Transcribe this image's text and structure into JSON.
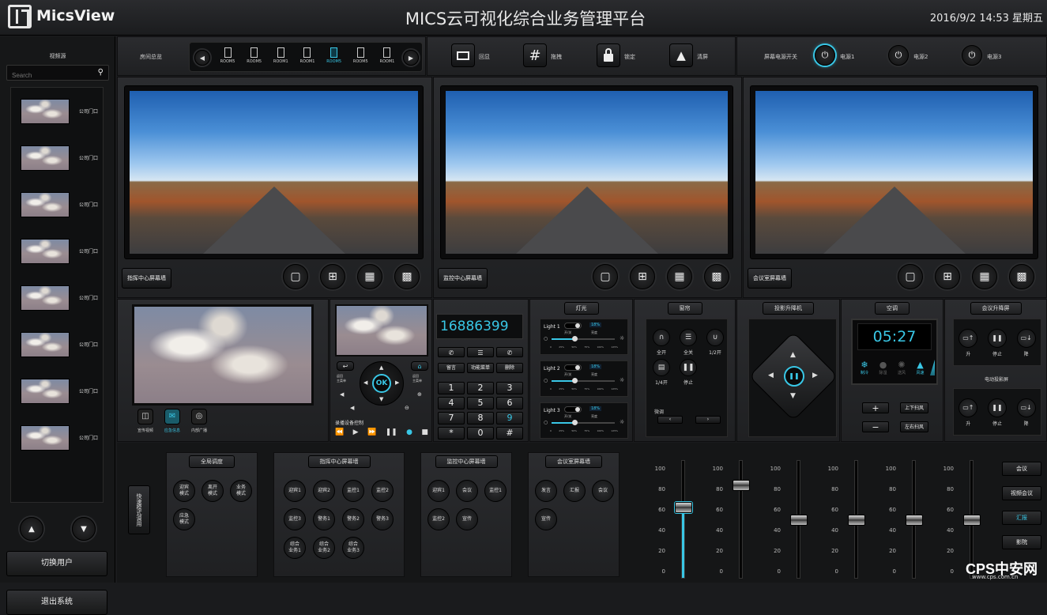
{
  "header": {
    "logo": "MicsView",
    "title": "MICS云可视化综合业务管理平台",
    "datetime": "2016/9/2 14:53 星期五"
  },
  "sidebar": {
    "title": "视频源",
    "search_placeholder": "Search",
    "items": [
      {
        "label": "公司门口"
      },
      {
        "label": "公司门口"
      },
      {
        "label": "公司门口"
      },
      {
        "label": "公司门口"
      },
      {
        "label": "公司门口"
      },
      {
        "label": "公司门口"
      },
      {
        "label": "公司门口"
      },
      {
        "label": "公司门口"
      }
    ],
    "switch_user": "切换用户",
    "logout": "退出系统"
  },
  "toolbar": {
    "room_label": "房间总览",
    "rooms": [
      "ROOM5",
      "ROOM5",
      "ROOM1",
      "ROOM1",
      "ROOM5",
      "ROOM5",
      "ROOM1"
    ],
    "actions": [
      {
        "label": "回显",
        "icon": "display-icon"
      },
      {
        "label": "拖拽",
        "icon": "grid-icon"
      },
      {
        "label": "锁定",
        "icon": "lock-icon"
      },
      {
        "label": "清屏",
        "icon": "broom-icon"
      }
    ],
    "power_label": "屏幕电源开关",
    "power": [
      {
        "label": "电源1",
        "active": true
      },
      {
        "label": "电源2",
        "active": false
      },
      {
        "label": "电源3",
        "active": false
      }
    ]
  },
  "walls": [
    {
      "label": "指挥中心屏幕墙"
    },
    {
      "label": "监控中心屏幕墙"
    },
    {
      "label": "会议室屏幕墙"
    }
  ],
  "preview": {
    "options": [
      {
        "label": "宣传视频"
      },
      {
        "label": "应急信息"
      },
      {
        "label": "内部广播"
      }
    ]
  },
  "remote": {
    "ok": "OK",
    "side_left": "返回\n主菜单",
    "side_right": "返回\n主菜单",
    "title": "录播设备控制"
  },
  "phone": {
    "number": "16886399",
    "functions": [
      "留言",
      "功能菜单",
      "删除"
    ],
    "keys": [
      "1",
      "2",
      "3",
      "4",
      "5",
      "6",
      "7",
      "8",
      "9",
      "*",
      "0",
      "#"
    ]
  },
  "lights": {
    "title": "灯光",
    "items": [
      {
        "name": "Light 1",
        "level": "18%",
        "state": "亮度"
      },
      {
        "name": "Light 2",
        "level": "18%",
        "state": "亮度"
      },
      {
        "name": "Light 3",
        "level": "18%",
        "state": "亮度"
      }
    ],
    "scale": [
      "0",
      "25%",
      "50%",
      "75%",
      "100%",
      "125%"
    ],
    "switch_label": "开/关"
  },
  "curtain": {
    "title": "窗帘",
    "buttons": [
      "全开",
      "全关",
      "1/2开",
      "1/4开",
      "停止"
    ],
    "fine": "微调"
  },
  "projector": {
    "title": "投影升降机"
  },
  "ac": {
    "title": "空调",
    "time": "05:27",
    "modes": [
      "制冷",
      "除湿",
      "送风",
      "风速"
    ],
    "swing_ud": "上下扫风",
    "swing_lr": "左右扫风",
    "plus": "+",
    "minus": "−"
  },
  "lift": {
    "title": "会议升降屏",
    "buttons": [
      "升",
      "停止",
      "降"
    ],
    "elec_title": "电动投影屏",
    "elec_buttons": [
      "升",
      "停止",
      "降"
    ]
  },
  "global": {
    "title": "全局调度",
    "buttons": [
      "迎宾\n模式",
      "离开\n模式",
      "业务\n模式",
      "应急\n模式"
    ]
  },
  "quick_mode": "快速模式调用",
  "cmd_wall": {
    "title": "指挥中心屏幕墙",
    "buttons": [
      "迎宾1",
      "迎宾2",
      "监控1",
      "监控2",
      "监控3",
      "警务1",
      "警务2",
      "警务3",
      "综合\n业务1",
      "综合\n业务2",
      "综合\n业务3"
    ]
  },
  "mon_wall": {
    "title": "监控中心屏幕墙",
    "buttons": [
      "迎宾1",
      "会议",
      "监控1",
      "监控2",
      "宣传"
    ]
  },
  "conf_wall": {
    "title": "会议室屏幕墙",
    "buttons": [
      "发言",
      "汇报",
      "会议",
      "宣传"
    ]
  },
  "mixer": {
    "scale": [
      "100",
      "80",
      "60",
      "40",
      "20",
      "0"
    ],
    "levels": [
      62,
      82,
      50,
      50,
      50,
      50
    ]
  },
  "scenes": [
    {
      "label": "会议",
      "active": false
    },
    {
      "label": "视频会议",
      "active": false
    },
    {
      "label": "汇报",
      "active": true
    },
    {
      "label": "影院",
      "active": false
    }
  ],
  "watermark": {
    "brand": "CPS中安网",
    "url": "www.cps.com.cn"
  },
  "colors": {
    "accent": "#39c7e6",
    "bg": "#1a1b1d"
  }
}
